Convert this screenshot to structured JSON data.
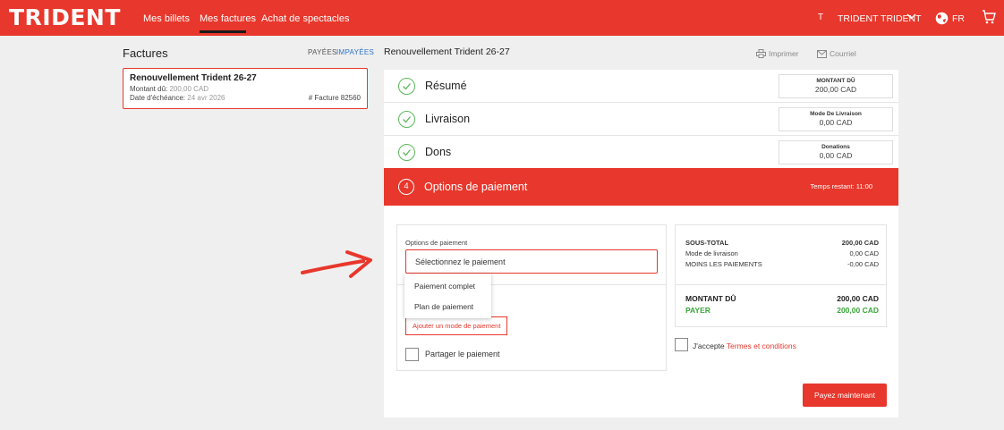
{
  "brand": {
    "logo_text": "TRIDENT",
    "accent_color": "#e8372c",
    "success_color": "#3aa53a",
    "link_color": "#2a73c8"
  },
  "nav": {
    "items": [
      {
        "label": "Mes billets"
      },
      {
        "label": "Mes factures",
        "active": true
      },
      {
        "label": "Achat de spectacles"
      }
    ],
    "user_initial": "T",
    "user_name": "TRIDENT TRIDENT",
    "language": "FR",
    "icons": [
      "chevron-down-icon",
      "globe-icon",
      "cart-icon"
    ]
  },
  "invoices": {
    "title": "Factures",
    "filters": {
      "paid": "PAYÉES",
      "unpaid": "IMPAYÉES",
      "selected": "unpaid"
    },
    "list": [
      {
        "title": "Renouvellement Trident 26-27",
        "amount_label": "Montant dû:",
        "amount_value": "200,00 CAD",
        "due_label": "Date d'échéance:",
        "due_value": "24 avr 2026",
        "number": "# Facture 82560"
      }
    ]
  },
  "main": {
    "title": "Renouvellement Trident 26-27",
    "print_label": "Imprimer",
    "email_label": "Courriel",
    "steps": [
      {
        "label": "Résumé",
        "summary_label": "MONTANT DÛ",
        "summary_value": "200,00 CAD",
        "done": true
      },
      {
        "label": "Livraison",
        "summary_label": "Mode De Livraison",
        "summary_value": "0,00 CAD",
        "done": true
      },
      {
        "label": "Dons",
        "summary_label": "Donations",
        "summary_value": "0,00 CAD",
        "done": true
      }
    ],
    "active_step": {
      "number": "4",
      "label": "Options de paiement",
      "time_left": "Temps restant: 11:00"
    }
  },
  "payment": {
    "options_label": "Options de paiement",
    "select_placeholder": "Sélectionnez le paiement",
    "dropdown_options": [
      "Paiement complet",
      "Plan de paiement"
    ],
    "add_method_label": "Ajouter un mode de paiement",
    "split_label": "Partager le paiement",
    "split_checked": false
  },
  "summary": {
    "subtotal_label": "SOUS-TOTAL",
    "subtotal_value": "200,00 CAD",
    "delivery_label": "Mode de livraison",
    "delivery_value": "0,00 CAD",
    "payments_label": "MOINS LES PAIEMENTS",
    "payments_value": "-0,00 CAD",
    "due_label": "MONTANT DÛ",
    "due_value": "200,00 CAD",
    "pay_label": "PAYER",
    "pay_value": "200,00 CAD",
    "terms_prefix": "J'accepte",
    "terms_link": "Termes et conditions",
    "terms_checked": false,
    "pay_button": "Payez maintenant"
  },
  "annotation": {
    "arrow_color": "#e8372c",
    "points_to": "select-payment-dropdown"
  }
}
